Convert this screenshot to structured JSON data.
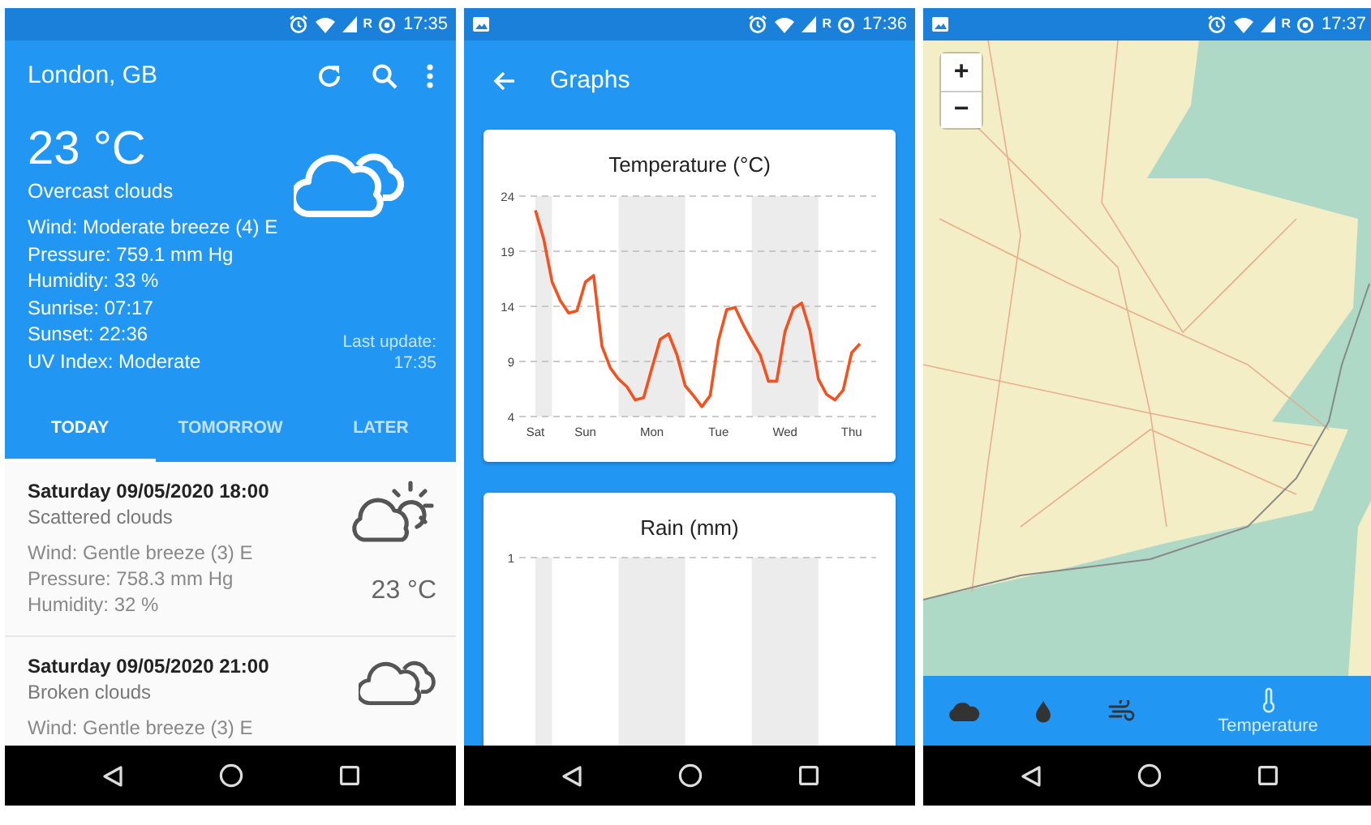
{
  "screens": [
    {
      "kind": "current_weather",
      "status_bar": {
        "roaming": "R",
        "time": "17:35"
      },
      "title": "London, GB",
      "current": {
        "temperature": "23 °C",
        "description": "Overcast clouds",
        "kind": "clouds",
        "details": [
          "Wind: Moderate breeze (4) E",
          "Pressure: 759.1 mm Hg",
          "Humidity: 33 %",
          "Sunrise: 07:17",
          "Sunset: 22:36",
          "UV Index: Moderate"
        ],
        "last_update_label": "Last update:",
        "last_update_time": "17:35"
      },
      "tabs": [
        {
          "label": "TODAY",
          "selected": true
        },
        {
          "label": "TOMORROW",
          "selected": false
        },
        {
          "label": "LATER",
          "selected": false
        }
      ],
      "forecast": [
        {
          "title": "Saturday 09/05/2020 18:00",
          "description": "Scattered clouds",
          "kind": "partly-cloudy",
          "details": [
            "Wind: Gentle breeze (3) E",
            "Pressure: 758.3 mm Hg",
            "Humidity: 32 %"
          ],
          "temperature": "23 °C"
        },
        {
          "title": "Saturday 09/05/2020 21:00",
          "description": "Broken clouds",
          "kind": "clouds",
          "details": [
            "Wind: Gentle breeze (3) E"
          ]
        }
      ]
    },
    {
      "kind": "graphs",
      "status_bar": {
        "notification_icon": true,
        "roaming": "R",
        "time": "17:36"
      },
      "title": "Graphs",
      "temperature_card": {
        "chart_data": {
          "type": "line",
          "title": "Temperature (°C)",
          "categories": [
            "Sat",
            null,
            null,
            null,
            null,
            null,
            "Sun",
            null,
            null,
            null,
            null,
            null,
            null,
            null,
            "Mon",
            null,
            null,
            null,
            null,
            null,
            null,
            null,
            "Tue",
            null,
            null,
            null,
            null,
            null,
            null,
            null,
            "Wed",
            null,
            null,
            null,
            null,
            null,
            null,
            null,
            "Thu",
            null
          ],
          "series": [
            {
              "color": "#f4511e",
              "values": [
                22.7,
                20.1,
                16.2,
                14.5,
                13.4,
                13.6,
                16.2,
                16.8,
                10.4,
                8.4,
                7.4,
                6.7,
                5.5,
                5.7,
                8.4,
                11,
                11.5,
                9.6,
                6.8,
                5.9,
                4.9,
                5.9,
                10.9,
                13.7,
                13.9,
                12.3,
                10.9,
                9.6,
                7.2,
                7.2,
                11.7,
                13.8,
                14.3,
                11.8,
                7.4,
                6,
                5.5,
                6.4,
                9.8,
                10.6
              ]
            }
          ],
          "ylim": [
            4,
            24
          ],
          "yticks": [
            4,
            9,
            14,
            19,
            24
          ],
          "grid": true
        }
      },
      "rain_card": {
        "title": "Rain (mm)",
        "ytick": "1"
      }
    },
    {
      "kind": "map",
      "status_bar": {
        "notification_icon": true,
        "roaming": "R",
        "time": "17:37"
      },
      "zoom_in": "+",
      "zoom_out": "−",
      "layers": [
        {
          "kind": "clouds",
          "selected": false
        },
        {
          "kind": "rain",
          "selected": false
        },
        {
          "kind": "wind",
          "selected": false
        },
        {
          "kind": "temperature",
          "label": "Temperature",
          "selected": true
        }
      ]
    }
  ]
}
